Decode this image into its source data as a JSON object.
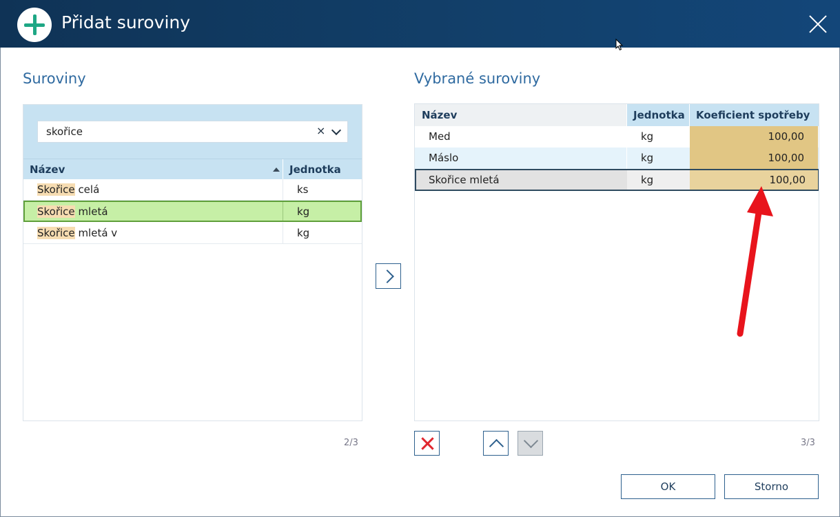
{
  "dialog": {
    "title": "Přidat suroviny",
    "icon": "plus-circle-icon",
    "close_icon": "close-icon"
  },
  "left": {
    "title": "Suroviny",
    "search_value": "skořice",
    "clear_label": "×",
    "columns": [
      "Název",
      "Jednotka"
    ],
    "rows": [
      {
        "highlight": "Skořice",
        "rest": " celá",
        "unit": "ks"
      },
      {
        "highlight": "Skořice",
        "rest": " mletá",
        "unit": "kg",
        "selected": true
      },
      {
        "highlight": "Skořice",
        "rest": " mletá v",
        "unit": "kg"
      }
    ],
    "count": "2/3"
  },
  "right": {
    "title": "Vybrané suroviny",
    "columns": [
      "Název",
      "Jednotka",
      "Koeficient spotřeby"
    ],
    "rows": [
      {
        "name": "Med",
        "unit": "kg",
        "coef": "100,00"
      },
      {
        "name": "Máslo",
        "unit": "kg",
        "coef": "100,00"
      },
      {
        "name": "Skořice mletá",
        "unit": "kg",
        "coef": "100,00"
      }
    ],
    "count": "3/3"
  },
  "buttons": {
    "ok": "OK",
    "cancel": "Storno"
  },
  "colors": {
    "titlebar": "#12406b",
    "accent": "#1ea785",
    "selected_row": "#c6efa6",
    "coef_cell": "#e1c684",
    "arrow": "#e8141c"
  }
}
